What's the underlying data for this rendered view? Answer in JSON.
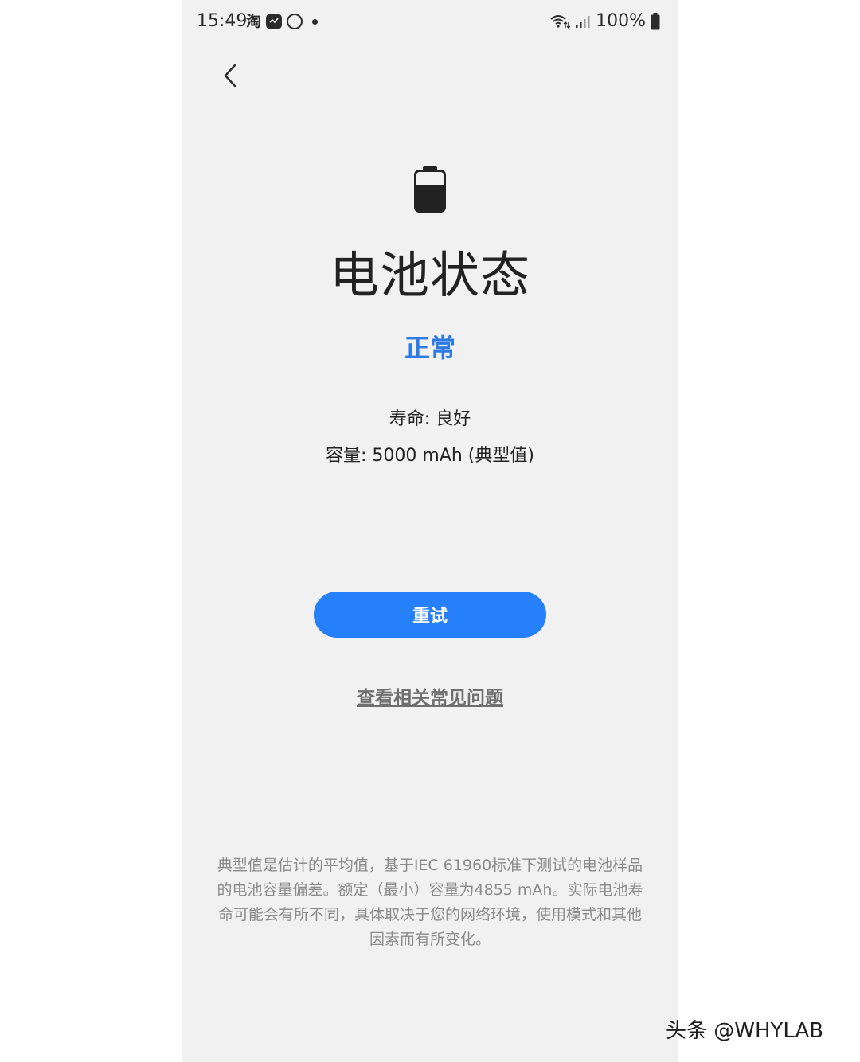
{
  "status_bar": {
    "time": "15:49",
    "app_taobao": "淘",
    "battery_percent": "100%"
  },
  "page": {
    "title": "电池状态",
    "status": "正常",
    "life": "寿命: 良好",
    "capacity": "容量: 5000 mAh (典型值)",
    "retry_label": "重试",
    "faq_label": "查看相关常见问题",
    "footnote": "典型值是估计的平均值，基于IEC 61960标准下测试的电池样品的电池容量偏差。额定（最小）容量为4855 mAh。实际电池寿命可能会有所不同，具体取决于您的网络环境，使用模式和其他因素而有所变化。"
  },
  "watermark": "头条 @WHYLAB",
  "colors": {
    "accent": "#2680fb",
    "status_text": "#2f7ae5",
    "background": "#f1f1f1"
  }
}
